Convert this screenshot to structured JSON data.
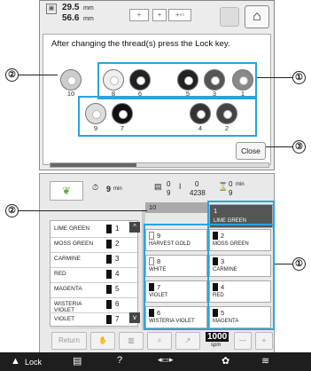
{
  "top": {
    "width_value": "29.5",
    "width_unit": "mm",
    "height_value": "56.6",
    "height_unit": "mm",
    "message": "After changing the thread(s) press the Lock key.",
    "close_label": "Close",
    "spools_row1": [
      {
        "num": "10",
        "color": "#cccccc"
      },
      {
        "num": "8",
        "color": "#eeeeee"
      },
      {
        "num": "6",
        "color": "#222222"
      },
      {
        "num": "5",
        "color": "#222222"
      },
      {
        "num": "3",
        "color": "#555555"
      },
      {
        "num": "1",
        "color": "#888888"
      }
    ],
    "spools_row2": [
      {
        "num": "9",
        "color": "#dddddd"
      },
      {
        "num": "7",
        "color": "#111111"
      },
      {
        "num": "4",
        "color": "#333333"
      },
      {
        "num": "2",
        "color": "#444444"
      }
    ]
  },
  "callouts": {
    "one": "①",
    "two": "②",
    "three": "③"
  },
  "status": {
    "time_value": "9",
    "time_unit": "min",
    "color_current": "0",
    "color_total": "9",
    "stitch_current": "0",
    "stitch_total": "4238",
    "remaining_value": "0",
    "remaining_unit": "min",
    "remaining_sub": "9"
  },
  "progress_fraction": 0.39,
  "left_list": [
    {
      "name": "LIME GREEN",
      "num": "1"
    },
    {
      "name": "MOSS GREEN",
      "num": "2"
    },
    {
      "name": "CARMINE",
      "num": "3"
    },
    {
      "name": "RED",
      "num": "4"
    },
    {
      "name": "MAGENTA",
      "num": "5"
    },
    {
      "name": "WISTERIA VIOLET",
      "num": "6"
    },
    {
      "name": "VIOLET",
      "num": "7"
    }
  ],
  "right_header": {
    "left_num": "10",
    "right_num": "1",
    "right_name": "LIME GREEN"
  },
  "right_list": [
    {
      "num": "9",
      "name": "HARVEST GOLD",
      "white": true
    },
    {
      "num": "2",
      "name": "MOSS GREEN",
      "white": false
    },
    {
      "num": "8",
      "name": "WHITE",
      "white": true
    },
    {
      "num": "3",
      "name": "CARMINE",
      "white": false
    },
    {
      "num": "7",
      "name": "VIOLET",
      "white": false
    },
    {
      "num": "4",
      "name": "RED",
      "white": false
    },
    {
      "num": "6",
      "name": "WISTERIA VIOLET",
      "white": false
    },
    {
      "num": "5",
      "name": "MAGENTA",
      "white": false
    }
  ],
  "toolbar": {
    "return_label": "Return",
    "speed_value": "1000",
    "speed_unit": "spm",
    "minus": "—",
    "plus": "+"
  },
  "footer": {
    "lock_label": "Lock"
  },
  "colors": {
    "accent": "#2aa4e0",
    "footer_bg": "#1e1e1e"
  }
}
